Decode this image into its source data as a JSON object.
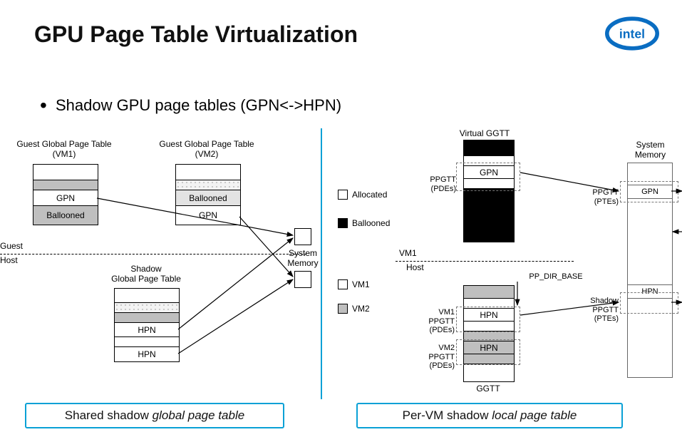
{
  "title": "GPU Page Table Virtualization",
  "bullet": "Shadow GPU page tables (GPN<->HPN)",
  "logo_text": "intel",
  "left": {
    "vm1_label": "Guest  Global Page Table\n(VM1)",
    "vm2_label": "Guest  Global Page Table\n(VM2)",
    "gpn": "GPN",
    "ballooned": "Ballooned",
    "shadow_label": "Shadow\nGlobal Page Table",
    "hpn": "HPN",
    "guest": "Guest",
    "host": "Host",
    "sysmem": "System\nMemory",
    "caption": "Shared shadow global page table",
    "caption_em": "global page table"
  },
  "legend": {
    "allocated": "Allocated",
    "ballooned": "Ballooned",
    "vm1": "VM1",
    "vm2": "VM2"
  },
  "right": {
    "virtual_ggtt": "Virtual GGTT",
    "ppgtt_pdes": "PPGTT\n(PDEs)",
    "gpn": "GPN",
    "sysmem": "System\nMemory",
    "ppgtt_ptes": "PPGTT\n(PTEs)",
    "vm1": "VM1",
    "host": "Host",
    "pp_dir_base": "PP_DIR_BASE",
    "vm1_ppgtt_pdes": "VM1\nPPGTT\n(PDEs)",
    "vm2_ppgtt_pdes": "VM2\nPPGTT\n(PDEs)",
    "shadow_ppgtt_ptes": "Shadow\nPPGTT\n(PTEs)",
    "hpn": "HPN",
    "ggtt": "GGTT",
    "caption": "Per-VM shadow local page table",
    "caption_em": "local page table"
  }
}
